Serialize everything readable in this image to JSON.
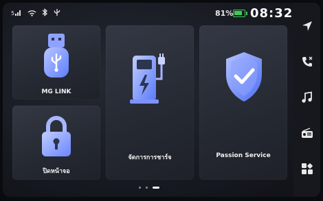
{
  "status_bar": {
    "icons": [
      "signal-icon",
      "wifi-icon",
      "bluetooth-icon",
      "usb-icon"
    ],
    "battery_percent": "81%",
    "time": "08:32"
  },
  "tiles": {
    "mg_link": {
      "label": "MG LINK"
    },
    "lock_screen": {
      "label": "ปิดหน้าจอ"
    },
    "charging": {
      "label": "จัดการการชาร์จ"
    },
    "passion_service": {
      "label": "Passion Service"
    }
  },
  "sidebar": {
    "items": [
      "navigation-icon",
      "phone-icon",
      "music-icon",
      "radio-icon",
      "apps-icon"
    ]
  },
  "pager": {
    "pages": 3,
    "active": 2
  },
  "colors": {
    "accent": "#6f8dff",
    "icon_blue": "#3c6cf0",
    "battery": "#3fc95a"
  }
}
